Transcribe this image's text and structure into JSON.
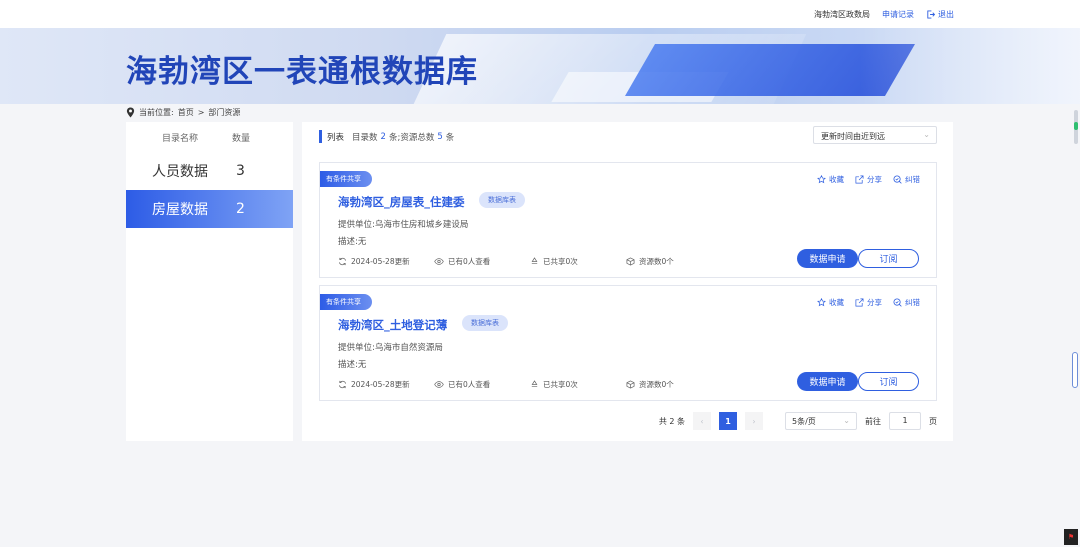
{
  "header": {
    "org": "海勃湾区政数局",
    "apply_records": "申请记录",
    "logout": "退出"
  },
  "banner": {
    "title": "海勃湾区一表通根数据库"
  },
  "breadcrumb": {
    "prefix": "当前位置:",
    "home": "首页",
    "separator": ">",
    "current": "部门资源"
  },
  "sidebar": {
    "col_name": "目录名称",
    "col_count": "数量",
    "items": [
      {
        "label": "人员数据",
        "count": "3",
        "active": false
      },
      {
        "label": "房屋数据",
        "count": "2",
        "active": true
      }
    ]
  },
  "list": {
    "label": "列表",
    "catalog_prefix": "目录数",
    "catalog_count": "2",
    "catalog_suffix": "条;资源总数",
    "resource_count": "5",
    "resource_suffix": "条",
    "sort_value": "更新时间由近到远"
  },
  "cards": [
    {
      "tag": "有条件共享",
      "name": "海勃湾区_房屋表_住建委",
      "type": "数据库表",
      "provider": "提供单位:乌海市住房和城乡建设局",
      "desc": "描述:无",
      "updated": "2024-05-28更新",
      "views": "已有0人查看",
      "shares": "已共享0次",
      "resources": "资源数0个",
      "actions": {
        "favorite": "收藏",
        "share": "分享",
        "report": "纠错"
      },
      "apply_btn": "数据申请",
      "subscribe_btn": "订阅"
    },
    {
      "tag": "有条件共享",
      "name": "海勃湾区_土地登记薄",
      "type": "数据库表",
      "provider": "提供单位:乌海市自然资源局",
      "desc": "描述:无",
      "updated": "2024-05-28更新",
      "views": "已有0人查看",
      "shares": "已共享0次",
      "resources": "资源数0个",
      "actions": {
        "favorite": "收藏",
        "share": "分享",
        "report": "纠错"
      },
      "apply_btn": "数据申请",
      "subscribe_btn": "订阅"
    }
  ],
  "pagination": {
    "total": "共 2 条",
    "prev": "‹",
    "current_page": "1",
    "next": "›",
    "page_size": "5条/页",
    "goto_prefix": "前往",
    "goto_value": "1",
    "goto_suffix": "页"
  },
  "colors": {
    "accent": "#2f5fe0",
    "title": "#2145b8"
  }
}
